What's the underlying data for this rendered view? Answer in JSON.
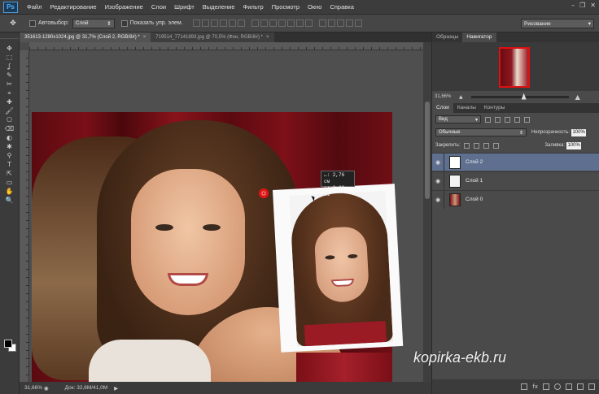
{
  "app": {
    "logo": "Ps"
  },
  "menu": [
    "Файл",
    "Редактирование",
    "Изображение",
    "Слои",
    "Шрифт",
    "Выделение",
    "Фильтр",
    "Просмотр",
    "Окно",
    "Справка"
  ],
  "window_controls": [
    "–",
    "❐",
    "✕"
  ],
  "options": {
    "tool_glyph": "✥",
    "autoselect_label": "Автовыбор:",
    "autoselect_value": "Слой",
    "show_controls_label": "Показать упр. элем.",
    "workspace": "Рисование"
  },
  "doc_tabs": [
    {
      "title": "351613-1280x1024.jpg @ 31,7% (Слой 2, RGB/8#) *",
      "active": true
    },
    {
      "title": "719514_77141893.jpg @ 70,5% (Фон, RGB/8#) *",
      "active": false
    }
  ],
  "tools": [
    "✥",
    "⬚",
    "ʆ",
    "✎",
    "✂",
    "⌖",
    "✚",
    "🖌",
    "⎔",
    "⌫",
    "◐",
    "✱",
    "⚲",
    "T",
    "⇱",
    "▭",
    "✋",
    "🔍"
  ],
  "canvas": {
    "measure_tip": {
      "line1": "↔: 2,76 см",
      "line2": "↕: 0,00 см"
    }
  },
  "status": {
    "zoom": "31,66%",
    "doc": "Док: 32,6M/41,0M"
  },
  "navigator": {
    "tabs": [
      "Образцы",
      "Навигатор"
    ],
    "active_tab": "Навигатор",
    "zoom": "31,66%"
  },
  "layers_panel": {
    "tabs": [
      "Слои",
      "Каналы",
      "Контуры"
    ],
    "active_tab": "Слои",
    "filter": "Вид",
    "blend_mode": "Обычные",
    "opacity_label": "Непрозрачность:",
    "opacity": "100%",
    "lock_label": "Закрепить:",
    "fill_label": "Заливка:",
    "fill": "100%",
    "layers": [
      {
        "name": "Слой 2",
        "selected": true
      },
      {
        "name": "Слой 1",
        "selected": false
      },
      {
        "name": "Слой 0",
        "selected": false
      }
    ],
    "footer_icons": [
      "link-icon",
      "fx-icon",
      "mask-icon",
      "adjustment-icon",
      "folder-icon",
      "new-layer-icon",
      "trash-icon"
    ]
  },
  "watermark": "kopirka-ekb.ru",
  "colors": {
    "accent": "#4fb3ff",
    "selected_layer": "#5f6f8f",
    "curtain": "#7a0f17"
  }
}
